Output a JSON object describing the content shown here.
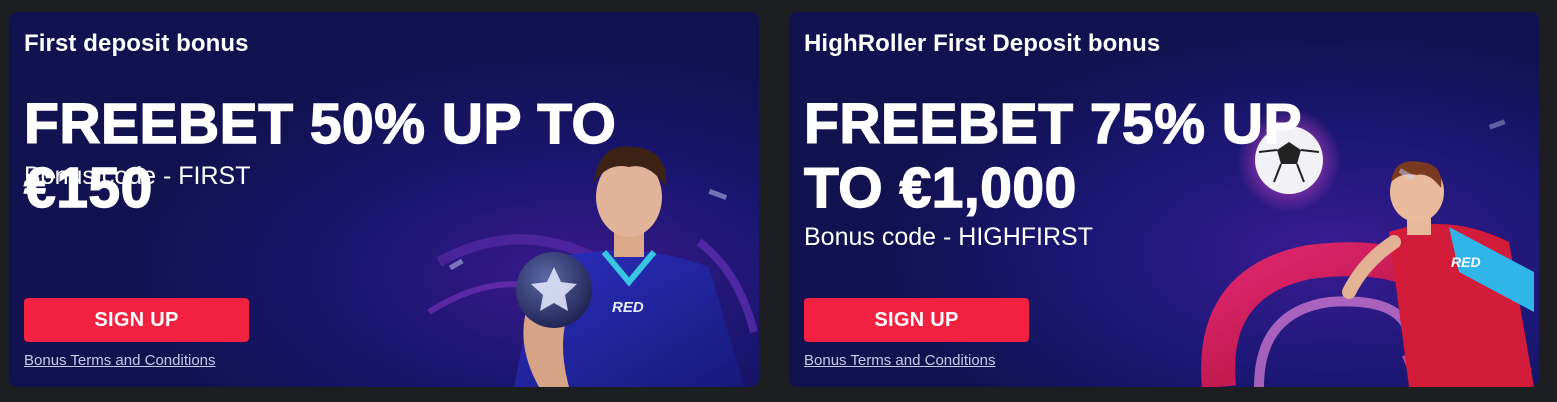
{
  "colors": {
    "page_background": "#1d1e22",
    "card_background": "#12125a",
    "signup_button": "#f2213f",
    "text": "#ffffff"
  },
  "promos": [
    {
      "title": "First deposit bonus",
      "headline": "FREEBET 50% UP TO €150",
      "bonus_code": "Bonus code - FIRST",
      "signup_label": "SIGN UP",
      "terms_label": "Bonus Terms and Conditions",
      "jersey_text": "RED"
    },
    {
      "title": "HighRoller First Deposit bonus",
      "headline": "FREEBET 75% UP TO €1,000",
      "bonus_code": "Bonus code - HIGHFIRST",
      "signup_label": "SIGN UP",
      "terms_label": "Bonus Terms and Conditions",
      "jersey_text": "RED"
    }
  ]
}
